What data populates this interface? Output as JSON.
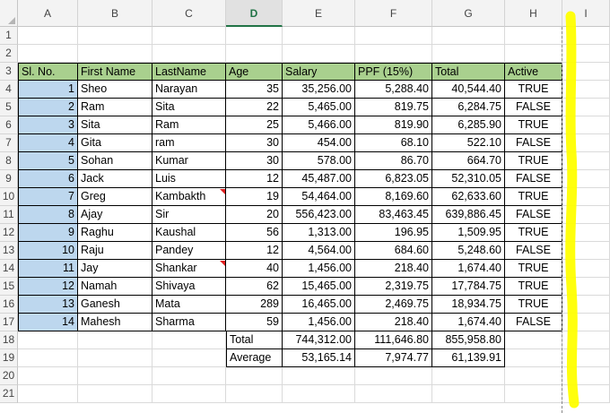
{
  "columns": [
    "A",
    "B",
    "C",
    "D",
    "E",
    "F",
    "G",
    "H",
    "I"
  ],
  "selected_column": "D",
  "row_numbers": [
    "1",
    "2",
    "3",
    "4",
    "5",
    "6",
    "7",
    "8",
    "9",
    "10",
    "11",
    "12",
    "13",
    "14",
    "15",
    "16",
    "17",
    "18",
    "19",
    "20",
    "21"
  ],
  "table": {
    "headers": [
      "Sl. No.",
      "First Name",
      "LastName",
      "Age",
      "Salary",
      "PPF (15%)",
      "Total",
      "Active"
    ],
    "rows": [
      [
        "1",
        "Sheo",
        "Narayan",
        "35",
        "35,256.00",
        "5,288.40",
        "40,544.40",
        "TRUE"
      ],
      [
        "2",
        "Ram",
        "Sita",
        "22",
        "5,465.00",
        "819.75",
        "6,284.75",
        "FALSE"
      ],
      [
        "3",
        "Sita",
        "Ram",
        "25",
        "5,466.00",
        "819.90",
        "6,285.90",
        "TRUE"
      ],
      [
        "4",
        "Gita",
        "ram",
        "30",
        "454.00",
        "68.10",
        "522.10",
        "FALSE"
      ],
      [
        "5",
        "Sohan",
        "Kumar",
        "30",
        "578.00",
        "86.70",
        "664.70",
        "TRUE"
      ],
      [
        "6",
        "Jack",
        "Luis",
        "12",
        "45,487.00",
        "6,823.05",
        "52,310.05",
        "FALSE"
      ],
      [
        "7",
        "Greg",
        "Kambakth",
        "19",
        "54,464.00",
        "8,169.60",
        "62,633.60",
        "TRUE"
      ],
      [
        "8",
        "Ajay",
        "Sir",
        "20",
        "556,423.00",
        "83,463.45",
        "639,886.45",
        "FALSE"
      ],
      [
        "9",
        "Raghu",
        "Kaushal",
        "56",
        "1,313.00",
        "196.95",
        "1,509.95",
        "TRUE"
      ],
      [
        "10",
        "Raju",
        "Pandey",
        "12",
        "4,564.00",
        "684.60",
        "5,248.60",
        "FALSE"
      ],
      [
        "11",
        "Jay",
        "Shankar",
        "40",
        "1,456.00",
        "218.40",
        "1,674.40",
        "TRUE"
      ],
      [
        "12",
        "Namah",
        "Shivaya",
        "62",
        "15,465.00",
        "2,319.75",
        "17,784.75",
        "TRUE"
      ],
      [
        "13",
        "Ganesh",
        "Mata",
        "289",
        "16,465.00",
        "2,469.75",
        "18,934.75",
        "TRUE"
      ],
      [
        "14",
        "Mahesh",
        "Sharma",
        "59",
        "1,456.00",
        "218.40",
        "1,674.40",
        "FALSE"
      ]
    ],
    "comment_rows": [
      6,
      10
    ],
    "summary": [
      {
        "label": "Total",
        "salary": "744,312.00",
        "ppf": "111,646.80",
        "total": "855,958.80"
      },
      {
        "label": "Average",
        "salary": "53,165.14",
        "ppf": "7,974.77",
        "total": "61,139.91"
      }
    ]
  },
  "colors": {
    "header_fill": "#a9d08e",
    "serial_fill": "#bdd7ee",
    "highlight": "#ffff00",
    "comment_marker": "#e02020"
  }
}
